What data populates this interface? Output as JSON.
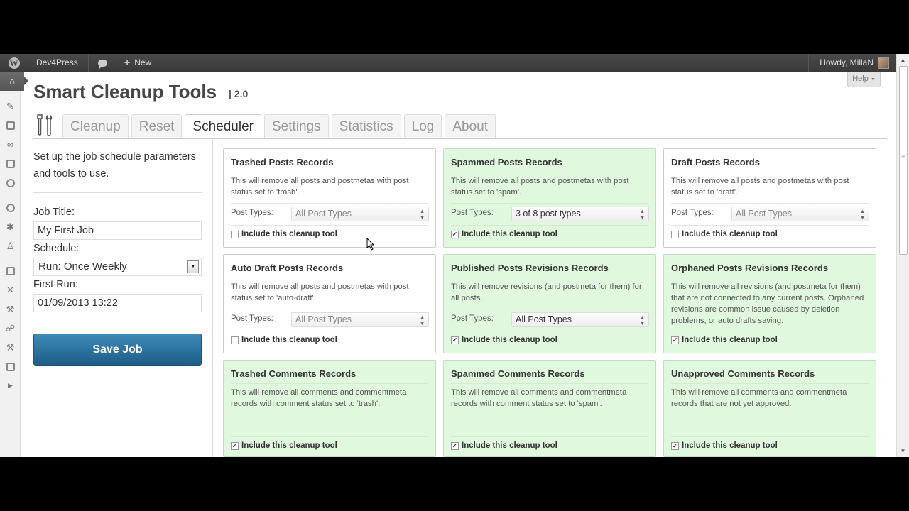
{
  "adminbar": {
    "site_name": "Dev4Press",
    "new_label": "New",
    "howdy": "Howdy, MillaN"
  },
  "help": {
    "label": "Help"
  },
  "page": {
    "title": "Smart Cleanup Tools",
    "version": "| 2.0"
  },
  "tabs": [
    "Cleanup",
    "Reset",
    "Scheduler",
    "Settings",
    "Statistics",
    "Log",
    "About"
  ],
  "active_tab": "Scheduler",
  "scheduler": {
    "intro": "Set up the job schedule parameters and tools to use.",
    "job_title_label": "Job Title:",
    "job_title_value": "My First Job",
    "schedule_label": "Schedule:",
    "schedule_value": "Run: Once Weekly",
    "first_run_label": "First Run:",
    "first_run_value": "01/09/2013 13:22",
    "save_label": "Save Job"
  },
  "tools": [
    {
      "title": "Trashed Posts Records",
      "desc": "This will remove all posts and postmetas with post status set to 'trash'.",
      "post_types_label": "Post Types:",
      "post_types": "All Post Types",
      "include_label": "Include this cleanup tool",
      "checked": false
    },
    {
      "title": "Spammed Posts Records",
      "desc": "This will remove all posts and postmetas with post status set to 'spam'.",
      "post_types_label": "Post Types:",
      "post_types": "3 of 8 post types",
      "include_label": "Include this cleanup tool",
      "checked": true
    },
    {
      "title": "Draft Posts Records",
      "desc": "This will remove all posts and postmetas with post status set to 'draft'.",
      "post_types_label": "Post Types:",
      "post_types": "All Post Types",
      "include_label": "Include this cleanup tool",
      "checked": false
    },
    {
      "title": "Auto Draft Posts Records",
      "desc": "This will remove all posts and postmetas with post status set to 'auto-draft'.",
      "post_types_label": "Post Types:",
      "post_types": "All Post Types",
      "include_label": "Include this cleanup tool",
      "checked": false
    },
    {
      "title": "Published Posts Revisions Records",
      "desc": "This will remove revisions (and postmeta for them) for all posts.",
      "post_types_label": "Post Types:",
      "post_types": "All Post Types",
      "include_label": "Include this cleanup tool",
      "checked": true
    },
    {
      "title": "Orphaned Posts Revisions Records",
      "desc": "This will remove all revisions (and postmeta for them) that are not connected to any current posts. Orphaned revisions are common issue caused by deletion problems, or auto drafts saving.",
      "include_label": "Include this cleanup tool",
      "checked": true
    },
    {
      "title": "Trashed Comments Records",
      "desc": "This will remove all comments and commentmeta records with comment status set to 'trash'.",
      "include_label": "Include this cleanup tool",
      "checked": true
    },
    {
      "title": "Spammed Comments Records",
      "desc": "This will remove all comments and commentmeta records with comment status set to 'spam'.",
      "include_label": "Include this cleanup tool",
      "checked": true
    },
    {
      "title": "Unapproved Comments Records",
      "desc": "This will remove all comments and commentmeta records that are not yet approved.",
      "include_label": "Include this cleanup tool",
      "checked": true
    }
  ],
  "colors": {
    "adminbar": "#464646",
    "enabled_card": "#e0f8dd",
    "save_button": "#2a6f9c"
  }
}
